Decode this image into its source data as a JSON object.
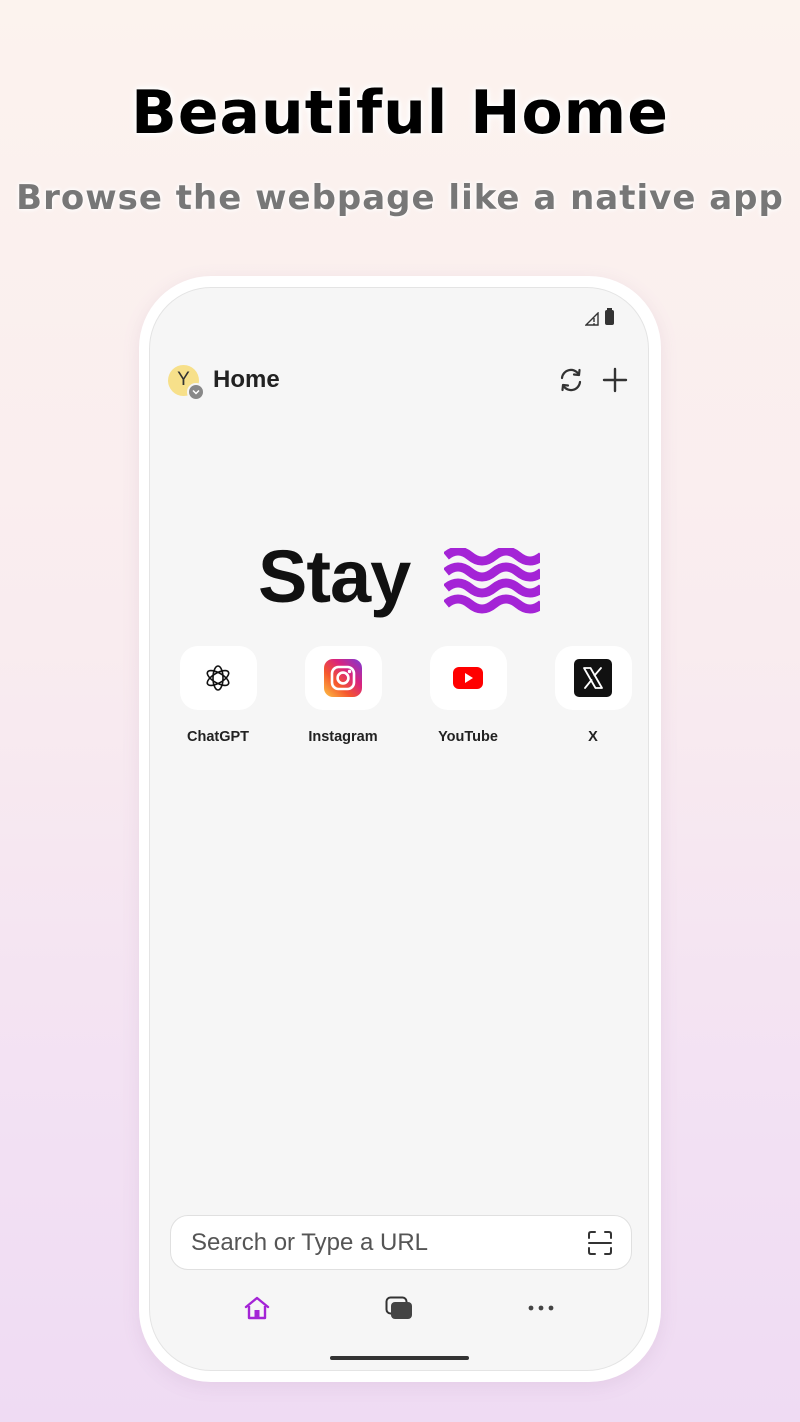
{
  "promo": {
    "headline": "Beautiful Home",
    "subline": "Browse the webpage like a native app"
  },
  "header": {
    "avatar_letter": "Y",
    "title": "Home",
    "refresh_icon": "refresh-icon",
    "add_icon": "plus-icon"
  },
  "logo": {
    "text": "Stay",
    "accent_color": "#b23ee6"
  },
  "shortcuts": [
    {
      "label": "ChatGPT",
      "icon": "chatgpt-icon"
    },
    {
      "label": "Instagram",
      "icon": "instagram-icon"
    },
    {
      "label": "YouTube",
      "icon": "youtube-icon"
    },
    {
      "label": "X",
      "icon": "x-icon"
    }
  ],
  "search": {
    "placeholder": "Search or Type a URL",
    "scan_icon": "scan-icon"
  },
  "bottom_nav": [
    {
      "name": "home",
      "icon": "home-icon",
      "active": true
    },
    {
      "name": "tabs",
      "icon": "tabs-icon",
      "active": false
    },
    {
      "name": "more",
      "icon": "more-icon",
      "active": false
    }
  ],
  "colors": {
    "accent": "#a424d6",
    "avatar_bg": "#f7e08a",
    "youtube_red": "#ff0000"
  }
}
